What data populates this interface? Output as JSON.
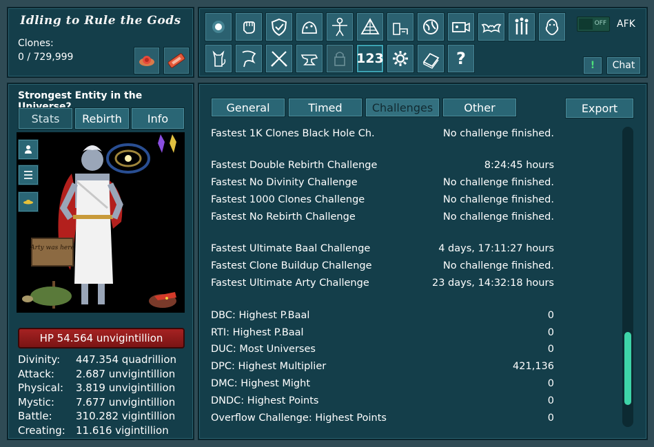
{
  "header": {
    "game_title": "Idling to Rule the Gods",
    "clones_label": "Clones:",
    "clones_value": "0 / 729,999"
  },
  "toolbar": {
    "row1_icons": [
      "light-orb-icon",
      "fist-icon",
      "shield-icon",
      "creature-icon",
      "human-figure-icon",
      "pyramid-icon",
      "farm-icon",
      "planet-icon",
      "camera-icon",
      "bat-icon",
      "pantheon-icon",
      "pet-icon"
    ],
    "row2_icons": [
      "cat-icon",
      "flag-icon",
      "crossed-swords-icon",
      "anvil-icon",
      "lock-icon",
      "number-icon",
      "gear-icon",
      "book-icon",
      "question-icon"
    ],
    "number_label": "123",
    "question_label": "?",
    "afk_toggle_text": "OFF",
    "afk_label": "AFK",
    "alert_label": "!",
    "chat_label": "Chat"
  },
  "entity": {
    "title": "Strongest Entity in the Universe?",
    "tabs": [
      "Stats",
      "Rebirth",
      "Info"
    ],
    "selected_tab": "Stats",
    "sign_text": "Arty was here",
    "hp_text": "HP 54.564 unvigintillion",
    "stats": [
      {
        "key": "Divinity:",
        "value": "447.354 quadrillion"
      },
      {
        "key": "Attack:",
        "value": "2.687 unvigintillion"
      },
      {
        "key": "Physical:",
        "value": "3.819 unvigintillion"
      },
      {
        "key": "Mystic:",
        "value": "7.677 unvigintillion"
      },
      {
        "key": "Battle:",
        "value": "310.282 vigintillion"
      },
      {
        "key": "Creating:",
        "value": "11.616 vigintillion"
      }
    ]
  },
  "main": {
    "tabs": [
      "General",
      "Timed",
      "Challenges",
      "Other"
    ],
    "selected_tab": "Challenges",
    "export_label": "Export",
    "scroll_position": 0.92,
    "challenges": [
      {
        "name": "Fastest 1K Clones Black Hole Ch.",
        "value": "No challenge finished."
      },
      {
        "name": "Fastest Double Rebirth Challenge",
        "value": "8:24:45 hours"
      },
      {
        "name": "Fastest No Divinity Challenge",
        "value": "No challenge finished."
      },
      {
        "name": "Fastest 1000 Clones Challenge",
        "value": "No challenge finished."
      },
      {
        "name": "Fastest No Rebirth Challenge",
        "value": "No challenge finished."
      },
      {
        "name": "Fastest Ultimate Baal Challenge",
        "value": "4 days, 17:11:27 hours"
      },
      {
        "name": "Fastest Clone Buildup Challenge",
        "value": "No challenge finished."
      },
      {
        "name": "Fastest Ultimate Arty Challenge",
        "value": "23 days, 14:32:18 hours"
      },
      {
        "name": "DBC: Highest P.Baal",
        "value": "0"
      },
      {
        "name": "RTI: Highest P.Baal",
        "value": "0"
      },
      {
        "name": "DUC: Most Universes",
        "value": "0"
      },
      {
        "name": "DPC: Highest Multiplier",
        "value": "421,136"
      },
      {
        "name": "DMC: Highest Might",
        "value": "0"
      },
      {
        "name": "DNDC: Highest Points",
        "value": "0"
      },
      {
        "name": "Overflow Challenge: Highest Points",
        "value": "0"
      }
    ]
  }
}
